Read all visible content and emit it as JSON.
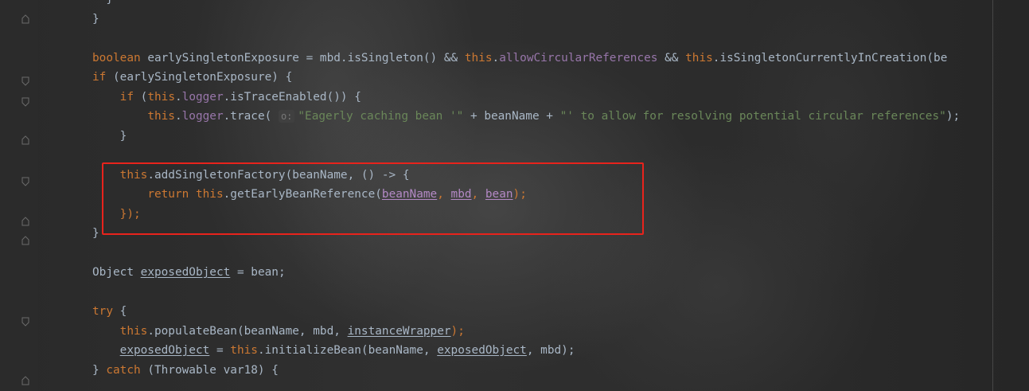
{
  "code": {
    "lines": [
      [
        {
          "t": "  }",
          "c": "plain"
        }
      ],
      [
        {
          "t": "}",
          "c": "plain"
        }
      ],
      [
        {
          "t": "",
          "c": "plain"
        }
      ],
      [
        {
          "t": "boolean ",
          "c": "kw"
        },
        {
          "t": "earlySingletonExposure = mbd.isSingleton() && ",
          "c": "plain"
        },
        {
          "t": "this",
          "c": "kw"
        },
        {
          "t": ".",
          "c": "plain"
        },
        {
          "t": "allowCircularReferences",
          "c": "fld"
        },
        {
          "t": " && ",
          "c": "plain"
        },
        {
          "t": "this",
          "c": "kw"
        },
        {
          "t": ".isSingletonCurrentlyInCreation(be",
          "c": "plain"
        }
      ],
      [
        {
          "t": "if ",
          "c": "kw"
        },
        {
          "t": "(earlySingletonExposure) {",
          "c": "plain"
        }
      ],
      [
        {
          "t": "    ",
          "c": "plain"
        },
        {
          "t": "if ",
          "c": "kw"
        },
        {
          "t": "(",
          "c": "plain"
        },
        {
          "t": "this",
          "c": "kw"
        },
        {
          "t": ".",
          "c": "plain"
        },
        {
          "t": "logger",
          "c": "fld"
        },
        {
          "t": ".isTraceEnabled()) {",
          "c": "plain"
        }
      ],
      [
        {
          "t": "        ",
          "c": "plain"
        },
        {
          "t": "this",
          "c": "kw"
        },
        {
          "t": ".",
          "c": "plain"
        },
        {
          "t": "logger",
          "c": "fld"
        },
        {
          "t": ".trace( ",
          "c": "plain"
        },
        {
          "t": "o:",
          "c": "hint"
        },
        {
          "t": "\"Eagerly caching bean '\"",
          "c": "str"
        },
        {
          "t": " + beanName + ",
          "c": "plain"
        },
        {
          "t": "\"' to allow for resolving potential circular references\"",
          "c": "str"
        },
        {
          "t": ");",
          "c": "plain"
        }
      ],
      [
        {
          "t": "    }",
          "c": "plain"
        }
      ],
      [
        {
          "t": "",
          "c": "plain"
        }
      ],
      [
        {
          "t": "    ",
          "c": "plain"
        },
        {
          "t": "this",
          "c": "kw"
        },
        {
          "t": ".addSingletonFactory(beanName, () -> {",
          "c": "plain"
        }
      ],
      [
        {
          "t": "        ",
          "c": "plain"
        },
        {
          "t": "return this",
          "c": "kw"
        },
        {
          "t": ".getEarlyBeanReference(",
          "c": "plain"
        },
        {
          "t": "beanName",
          "c": "ucap"
        },
        {
          "t": ", ",
          "c": "kw"
        },
        {
          "t": "mbd",
          "c": "ucap"
        },
        {
          "t": ", ",
          "c": "kw"
        },
        {
          "t": "bean",
          "c": "ucap"
        },
        {
          "t": ");",
          "c": "kw"
        }
      ],
      [
        {
          "t": "    });",
          "c": "kw"
        }
      ],
      [
        {
          "t": "}",
          "c": "plain"
        }
      ],
      [
        {
          "t": "",
          "c": "plain"
        }
      ],
      [
        {
          "t": "Object ",
          "c": "plain"
        },
        {
          "t": "exposedObject",
          "c": "uvar"
        },
        {
          "t": " = bean;",
          "c": "plain"
        }
      ],
      [
        {
          "t": "",
          "c": "plain"
        }
      ],
      [
        {
          "t": "try ",
          "c": "kw"
        },
        {
          "t": "{",
          "c": "plain"
        }
      ],
      [
        {
          "t": "    ",
          "c": "plain"
        },
        {
          "t": "this",
          "c": "kw"
        },
        {
          "t": ".populateBean(beanName, mbd, ",
          "c": "plain"
        },
        {
          "t": "instanceWrapper",
          "c": "uvar"
        },
        {
          "t": ");",
          "c": "kw"
        }
      ],
      [
        {
          "t": "    ",
          "c": "plain"
        },
        {
          "t": "exposedObject",
          "c": "uvar"
        },
        {
          "t": " = ",
          "c": "plain"
        },
        {
          "t": "this",
          "c": "kw"
        },
        {
          "t": ".initializeBean(beanName, ",
          "c": "plain"
        },
        {
          "t": "exposedObject",
          "c": "uvar"
        },
        {
          "t": ", mbd);",
          "c": "plain"
        }
      ],
      [
        {
          "t": "} ",
          "c": "plain"
        },
        {
          "t": "catch ",
          "c": "kw"
        },
        {
          "t": "(Throwable var18) {",
          "c": "plain"
        }
      ]
    ]
  },
  "colors": {
    "keyword": "#cc7832",
    "field": "#9876aa",
    "string": "#6a8759",
    "default": "#a9b7c6",
    "highlight_border": "#e8231c"
  }
}
